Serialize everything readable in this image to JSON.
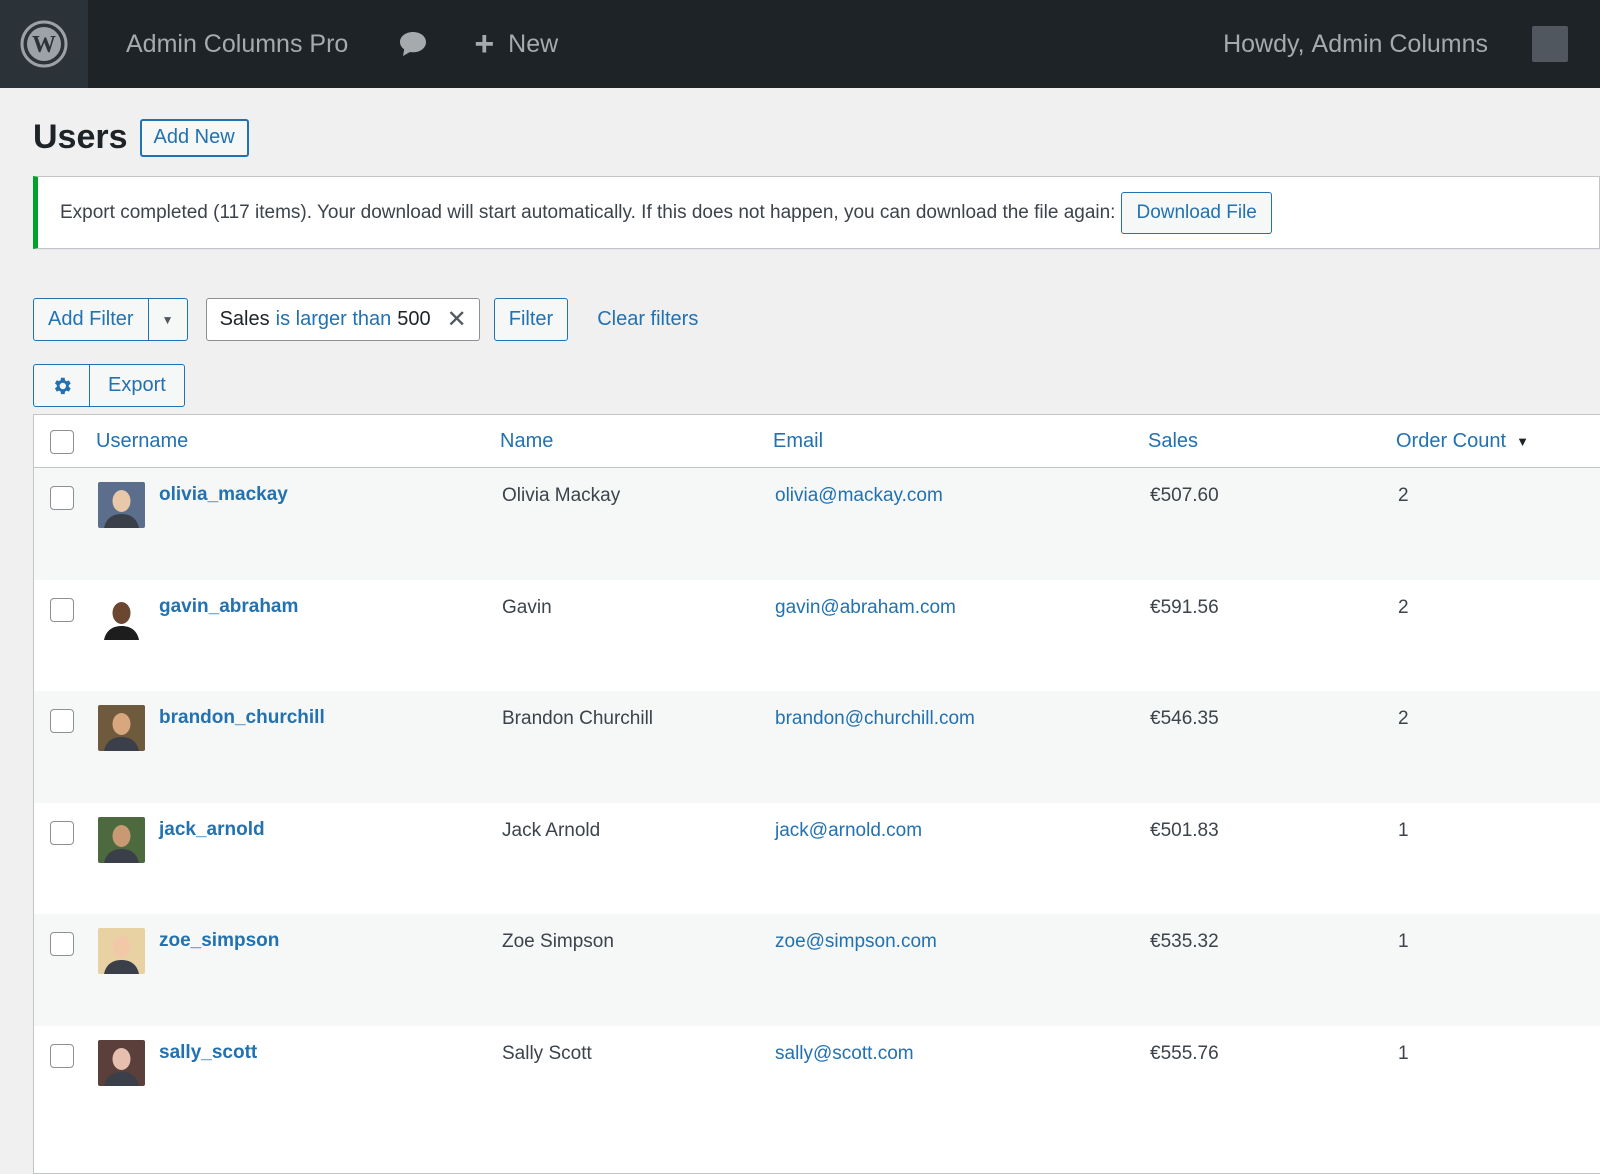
{
  "adminbar": {
    "site_name": "Admin Columns Pro",
    "new_label": "New",
    "howdy": "Howdy,",
    "user_name": "Admin Columns"
  },
  "page": {
    "title": "Users",
    "add_new": "Add New"
  },
  "notice": {
    "text": "Export completed (117 items). Your download will start automatically. If this does not happen, you can download the file again:",
    "button": "Download File"
  },
  "filters": {
    "add_filter": "Add Filter",
    "chip_field": "Sales",
    "chip_operator": "is larger than",
    "chip_value": "500",
    "filter_button": "Filter",
    "clear": "Clear filters"
  },
  "toolbar": {
    "export": "Export"
  },
  "table": {
    "columns": {
      "username": "Username",
      "name": "Name",
      "email": "Email",
      "sales": "Sales",
      "order_count": "Order Count"
    },
    "rows": [
      {
        "username": "olivia_mackay",
        "name": "Olivia Mackay",
        "email": "olivia@mackay.com",
        "sales": "€507.60",
        "orders": "2",
        "avatar_bg": "#5b6f8c",
        "avatar_fg": "#e7c8a8"
      },
      {
        "username": "gavin_abraham",
        "name": "Gavin",
        "email": "gavin@abraham.com",
        "sales": "€591.56",
        "orders": "2",
        "avatar_bg": "#ffffff",
        "avatar_fg": "#6b4631"
      },
      {
        "username": "brandon_churchill",
        "name": "Brandon Churchill",
        "email": "brandon@churchill.com",
        "sales": "€546.35",
        "orders": "2",
        "avatar_bg": "#6e5a3c",
        "avatar_fg": "#d9a77f"
      },
      {
        "username": "jack_arnold",
        "name": "Jack Arnold",
        "email": "jack@arnold.com",
        "sales": "€501.83",
        "orders": "1",
        "avatar_bg": "#4c6a3e",
        "avatar_fg": "#c79a73"
      },
      {
        "username": "zoe_simpson",
        "name": "Zoe Simpson",
        "email": "zoe@simpson.com",
        "sales": "€535.32",
        "orders": "1",
        "avatar_bg": "#e8d2a4",
        "avatar_fg": "#f1c9a8"
      },
      {
        "username": "sally_scott",
        "name": "Sally Scott",
        "email": "sally@scott.com",
        "sales": "€555.76",
        "orders": "1",
        "avatar_bg": "#5a3f3a",
        "avatar_fg": "#e6bfb0"
      }
    ]
  }
}
